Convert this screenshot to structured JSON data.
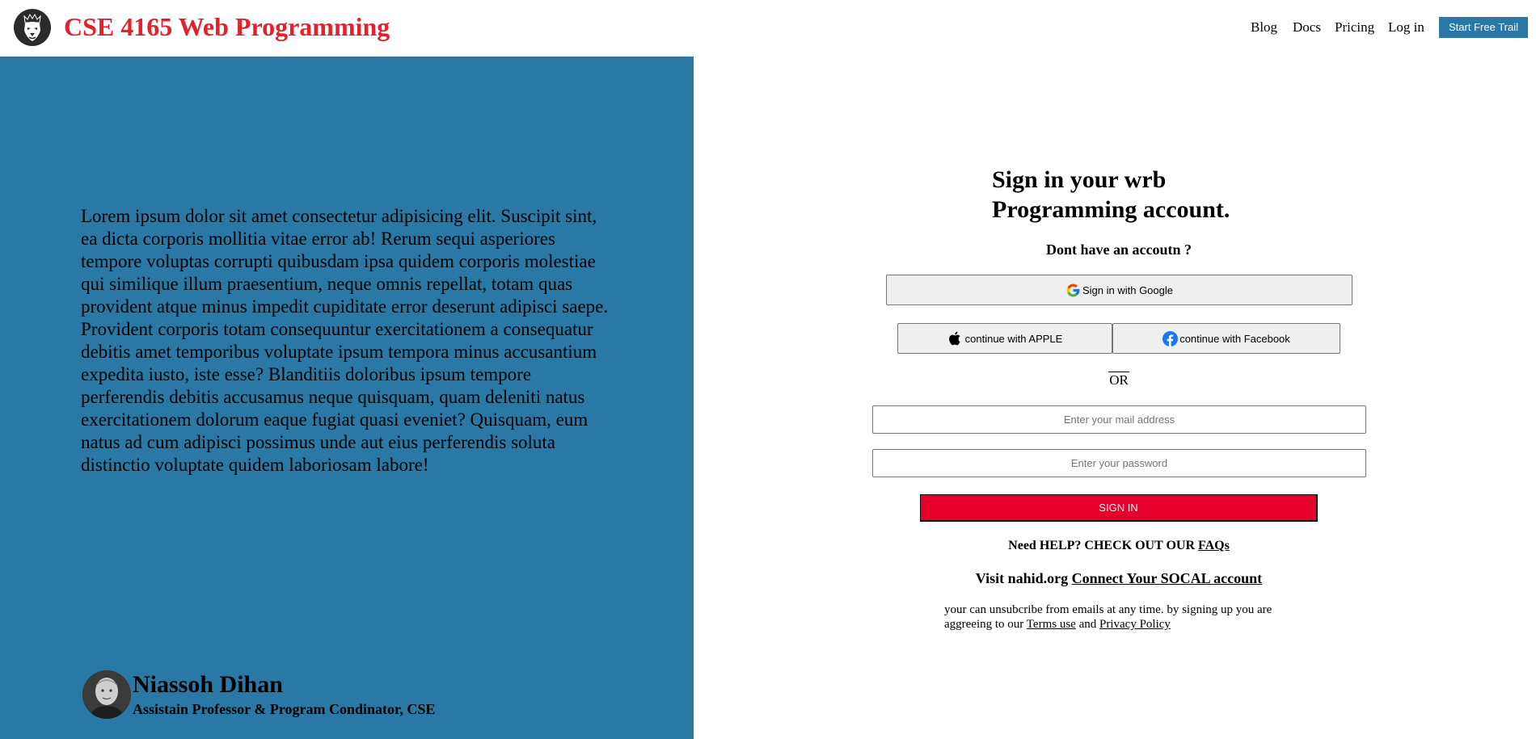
{
  "header": {
    "brand": "CSE 4165 Web Programming",
    "logo_icon": "lion-logo-icon",
    "nav": [
      "Blog",
      "Docs",
      "Pricing",
      "Log in"
    ],
    "cta_label": "Start Free Trail"
  },
  "left": {
    "body_text": "Lorem ipsum dolor sit amet consectetur adipisicing elit. Suscipit sint, ea dicta corporis mollitia vitae error ab! Rerum sequi asperiores tempore voluptas corrupti quibusdam ipsa quidem corporis molestiae qui similique illum praesentium, neque omnis repellat, totam quas provident atque minus impedit cupiditate error deserunt adipisci saepe. Provident corporis totam consequuntur exercitationem a consequatur debitis amet temporibus voluptate ipsum tempora minus accusantium expedita iusto, iste esse? Blanditiis doloribus ipsum tempore perferendis debitis accusamus neque quisquam, quam deleniti natus exercitationem dolorum eaque fugiat quasi eveniet? Quisquam, eum natus ad cum adipisci possimus unde aut eius perferendis soluta distinctio voluptate quidem laboriosam labore!",
    "author": {
      "name": "Niassoh Dihan",
      "title": "Assistain Professor & Program Condinator, CSE"
    }
  },
  "signin": {
    "heading_line1": "Sign in your wrb",
    "heading_line2": "Programming account.",
    "no_account": "Dont have an accoutn ?",
    "google_label": "Sign in with Google",
    "apple_label": "continue with APPLE",
    "facebook_label": "continue with Facebook",
    "or_label": "OR",
    "email_placeholder": "Enter your mail address",
    "password_placeholder": "Enter your password",
    "submit_label": "SIGN IN",
    "help_text": "Need HELP? CHECK OUT OUR",
    "faq_link": "FAQs",
    "visit_text": "Visit nahid.org",
    "connect_link": "Connect Your SOCAL account",
    "legal_text": "your can unsubcribe from emails at any time. by signing up you are aggreeing to our",
    "terms_link": "Terms use",
    "and_text": "and",
    "privacy_link": "Privacy Policy"
  },
  "colors": {
    "brand_red": "#e4202d",
    "panel_blue": "#2a78a6",
    "signin_red": "#e4002b",
    "facebook_blue": "#1877f2"
  }
}
